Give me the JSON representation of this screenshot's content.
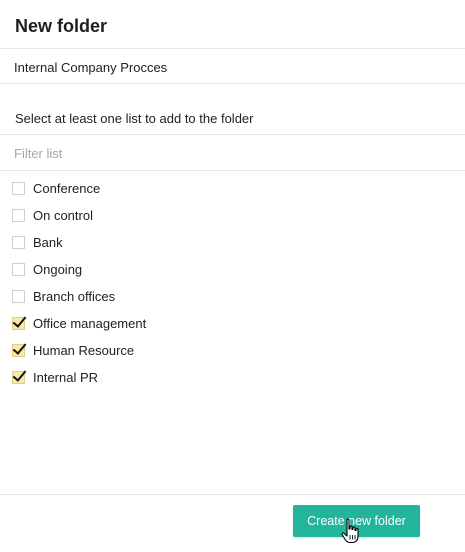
{
  "dialog": {
    "title": "New folder",
    "name_value": "Internal Company Procces",
    "instruction": "Select at least one list to add to the folder",
    "filter_placeholder": "Filter list",
    "lists": [
      {
        "label": "Conference",
        "checked": false
      },
      {
        "label": "On control",
        "checked": false
      },
      {
        "label": "Bank",
        "checked": false
      },
      {
        "label": "Ongoing",
        "checked": false
      },
      {
        "label": "Branch offices",
        "checked": false
      },
      {
        "label": "Office management",
        "checked": true
      },
      {
        "label": "Human Resource",
        "checked": true
      },
      {
        "label": "Internal PR",
        "checked": true
      }
    ],
    "create_button_label": "Create new folder"
  },
  "colors": {
    "accent": "#22b59c",
    "checkbox_checked_fill": "#fbe9a8",
    "divider": "#e6e6e6"
  },
  "icons": {
    "checkmark": "checkmark-icon",
    "cursor": "hand-pointer-cursor-icon"
  }
}
